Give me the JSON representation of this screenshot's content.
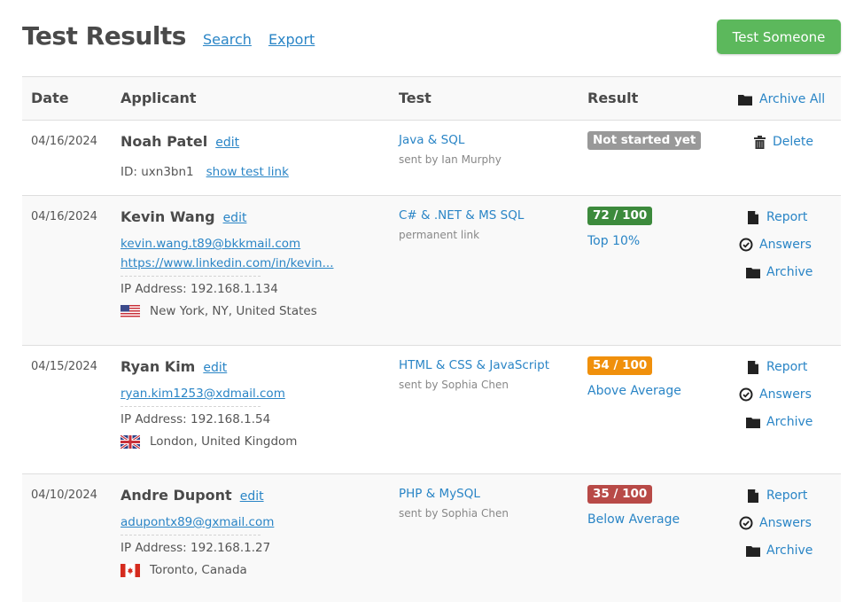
{
  "header": {
    "title": "Test Results",
    "links": [
      "Search",
      "Export"
    ],
    "cta_label": "Test Someone"
  },
  "table": {
    "columns": [
      "Date",
      "Applicant",
      "Test",
      "Result"
    ],
    "archive_all_label": "Archive All",
    "rows": [
      {
        "date": "04/16/2024",
        "name": "Noah Patel",
        "edit_label": "edit",
        "id_text": "ID: uxn3bn1",
        "show_link_label": "show test link",
        "test": "Java & SQL",
        "test_sub": "sent by Ian Murphy",
        "result_badge": "Not started yet",
        "result_color": "#999999",
        "actions": [
          "Delete"
        ]
      },
      {
        "date": "04/16/2024",
        "name": "Kevin Wang",
        "edit_label": "edit",
        "email": "kevin.wang.t89@bkkmail.com",
        "profile_link": "https://www.linkedin.com/in/kevin...",
        "ip": "IP Address: 192.168.1.134",
        "location": "New York, NY, United States",
        "flag": "us-flag",
        "test": "C# & .NET & MS SQL",
        "test_sub": "permanent link",
        "result_badge": "72 / 100",
        "score": 72,
        "max_score": 100,
        "result_color": "#3c8a3c",
        "percentile": "Top 10%",
        "actions": [
          "Report",
          "Answers",
          "Archive"
        ]
      },
      {
        "date": "04/15/2024",
        "name": "Ryan Kim",
        "edit_label": "edit",
        "email": "ryan.kim1253@xdmail.com",
        "ip": "IP Address: 192.168.1.54",
        "location": "London, United Kingdom",
        "flag": "uk-flag",
        "test": "HTML & CSS & JavaScript",
        "test_sub": "sent by Sophia Chen",
        "result_badge": "54 / 100",
        "score": 54,
        "max_score": 100,
        "result_color": "#f0900c",
        "percentile": "Above Average",
        "actions": [
          "Report",
          "Answers",
          "Archive"
        ]
      },
      {
        "date": "04/10/2024",
        "name": "Andre Dupont",
        "edit_label": "edit",
        "email": "adupontx89@gxmail.com",
        "ip": "IP Address: 192.168.1.27",
        "location": "Toronto, Canada",
        "flag": "canada-flag",
        "test": "PHP & MySQL",
        "test_sub": "sent by Sophia Chen",
        "result_badge": "35 / 100",
        "score": 35,
        "max_score": 100,
        "result_color": "#b84a47",
        "percentile": "Below Average",
        "actions": [
          "Report",
          "Answers",
          "Archive"
        ]
      }
    ]
  }
}
